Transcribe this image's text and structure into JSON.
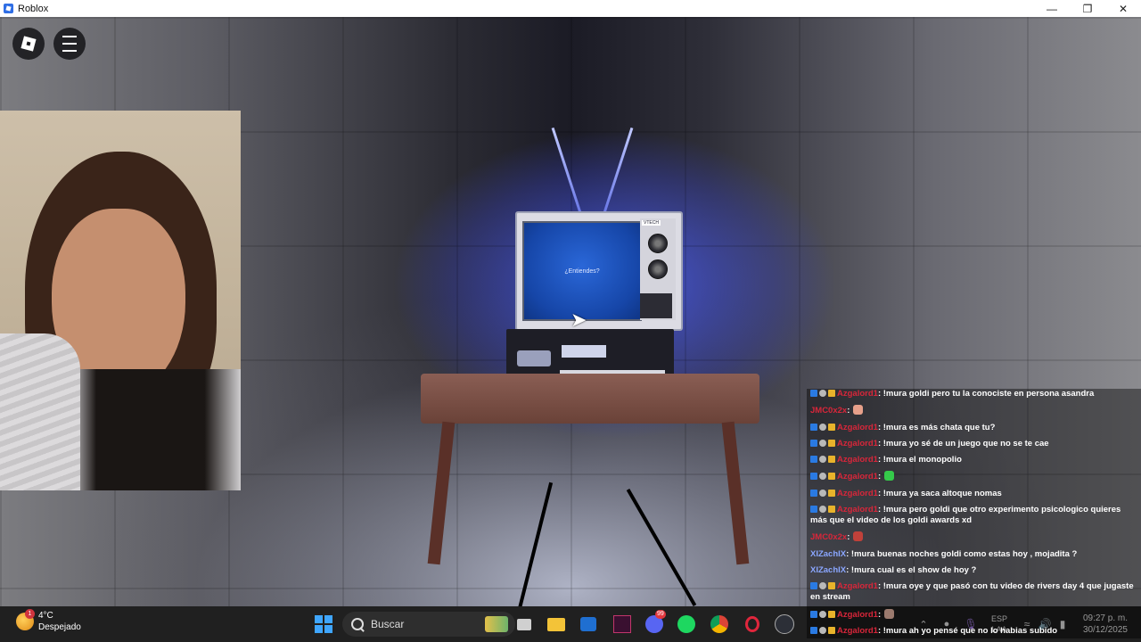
{
  "window": {
    "title": "Roblox"
  },
  "game": {
    "tv_screen_text": "¿Entiendes?",
    "tv_brand": "VTECH"
  },
  "chat": {
    "messages": [
      {
        "user": "Azgalord1",
        "badges": 3,
        "text": ": !mura goldi pero tu la conociste en persona asandra"
      },
      {
        "user": "JMC0x2x",
        "badges": 0,
        "text": ":",
        "emote": "#e7a08a"
      },
      {
        "user": "Azgalord1",
        "badges": 3,
        "text": ": !mura es más chata que tu?"
      },
      {
        "user": "Azgalord1",
        "badges": 3,
        "text": ": !mura yo sé de un juego que no se te cae"
      },
      {
        "user": "Azgalord1",
        "badges": 3,
        "text": ": !mura el monopolio"
      },
      {
        "user": "Azgalord1",
        "badges": 3,
        "text": ":",
        "emote": "#35c94a"
      },
      {
        "user": "Azgalord1",
        "badges": 3,
        "text": ": !mura ya saca altoque nomas"
      },
      {
        "user": "Azgalord1",
        "badges": 3,
        "text": ": !mura pero goldi que otro experimento psicologico quieres más que el video de los goldi awards xd"
      },
      {
        "user": "JMC0x2x",
        "badges": 0,
        "text": ":",
        "emote": "#c0413a"
      },
      {
        "user": "XIZachIX",
        "badges": 0,
        "blue": true,
        "text": ": !mura buenas noches goldi como estas hoy , mojadita ?"
      },
      {
        "user": "XIZachIX",
        "badges": 0,
        "blue": true,
        "text": ": !mura cual es el show de hoy ?"
      },
      {
        "user": "Azgalord1",
        "badges": 3,
        "text": ": !mura oye y que pasó con tu video de rivers day 4 que jugaste en stream"
      },
      {
        "user": "Azgalord1",
        "badges": 3,
        "text": ":",
        "emote": "#9b7a6e"
      },
      {
        "user": "Azgalord1",
        "badges": 3,
        "text": ": !mura ah yo pensé que no lo habias subido"
      }
    ]
  },
  "taskbar": {
    "weather_temp": "4°C",
    "weather_desc": "Despejado",
    "weather_badge": "1",
    "search_placeholder": "Buscar",
    "discord_badge": "99",
    "language": "ESP",
    "language_sub": "LAA",
    "time": "09:27 p. m.",
    "date": "30/12/2025"
  }
}
